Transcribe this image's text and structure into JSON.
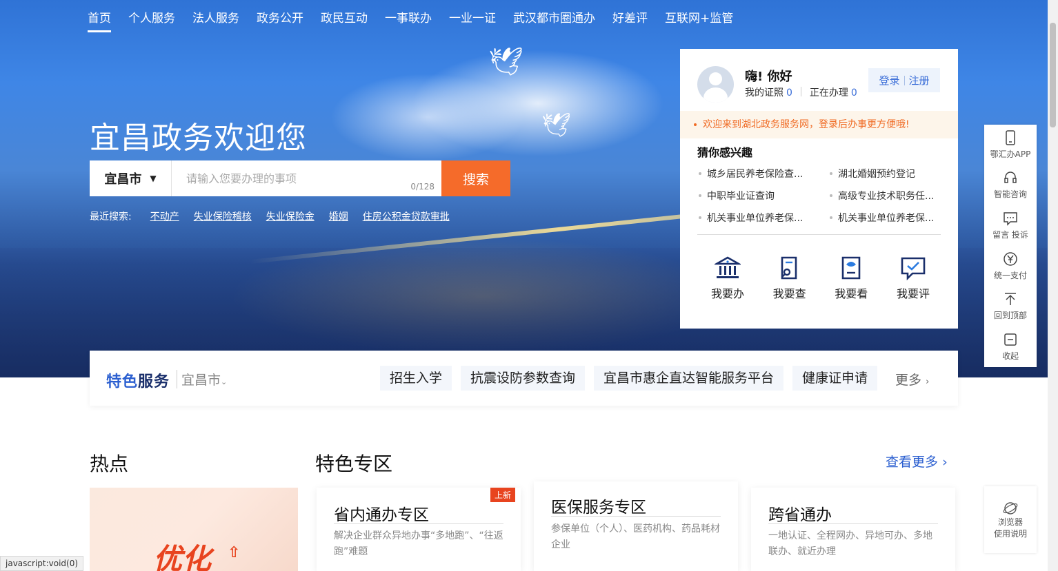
{
  "nav": {
    "items": [
      {
        "label": "首页",
        "active": true
      },
      {
        "label": "个人服务"
      },
      {
        "label": "法人服务"
      },
      {
        "label": "政务公开"
      },
      {
        "label": "政民互动"
      },
      {
        "label": "一事联办"
      },
      {
        "label": "一业一证"
      },
      {
        "label": "武汉都市圈通办"
      },
      {
        "label": "好差评"
      },
      {
        "label": "互联网+监管"
      }
    ]
  },
  "hero": {
    "welcome": "宜昌政务欢迎您",
    "city": "宜昌市",
    "search_placeholder": "请输入您要办理的事项",
    "search_counter": "0/128",
    "search_button": "搜索",
    "recent_label": "最近搜索:",
    "recent": [
      "不动产",
      "失业保险稽核",
      "失业保险金",
      "婚姻",
      "住房公积金贷款审批"
    ]
  },
  "user_card": {
    "greeting": "嗨! 你好",
    "certs_label": "我的证照",
    "certs_count": "0",
    "processing_label": "正在办理",
    "processing_count": "0",
    "login": "登录",
    "register": "注册",
    "notice": "欢迎来到湖北政务服务网，登录后办事更方便哦!",
    "guess_title": "猜你感兴趣",
    "guess_items": [
      "城乡居民养老保险查...",
      "湖北婚姻预约登记",
      "中职毕业证查询",
      "高级专业技术职务任...",
      "机关事业单位养老保...",
      "机关事业单位养老保..."
    ],
    "quick": [
      {
        "label": "我要办",
        "icon": "bank-icon"
      },
      {
        "label": "我要查",
        "icon": "search-doc-icon"
      },
      {
        "label": "我要看",
        "icon": "view-doc-icon"
      },
      {
        "label": "我要评",
        "icon": "comment-check-icon"
      }
    ]
  },
  "side_tools": [
    {
      "label": "鄂汇办APP",
      "icon": "phone-icon"
    },
    {
      "label": "智能咨询",
      "icon": "headset-icon"
    },
    {
      "label": "留言 投诉",
      "icon": "message-icon"
    },
    {
      "label": "统一支付",
      "icon": "yen-icon"
    },
    {
      "label": "回到顶部",
      "icon": "arrow-up-icon"
    },
    {
      "label": "收起",
      "icon": "collapse-icon"
    }
  ],
  "browser_help": {
    "line1": "浏览器",
    "line2": "使用说明"
  },
  "feature_bar": {
    "brand_1": "特色",
    "brand_2": "服务",
    "city": "宜昌市",
    "tags": [
      "招生入学",
      "抗震设防参数查询",
      "宜昌市惠企直达智能服务平台",
      "健康证申请"
    ],
    "more": "更多"
  },
  "sections": {
    "hot": "热点",
    "special": "特色专区",
    "see_more": "查看更多",
    "hot_banner_text": "优化"
  },
  "zones": [
    {
      "title": "省内通办专区",
      "desc": "解决企业群众异地办事“多地跑”、“往返跑”难题",
      "badge": "上新"
    },
    {
      "title": "医保服务专区",
      "desc": "参保单位（个人）、医药机构、药品耗材企业"
    },
    {
      "title": "跨省通办",
      "desc": "一地认证、全程网办、异地可办、多地联办、就近办理"
    }
  ],
  "status_bar": "javascript:void(0)"
}
